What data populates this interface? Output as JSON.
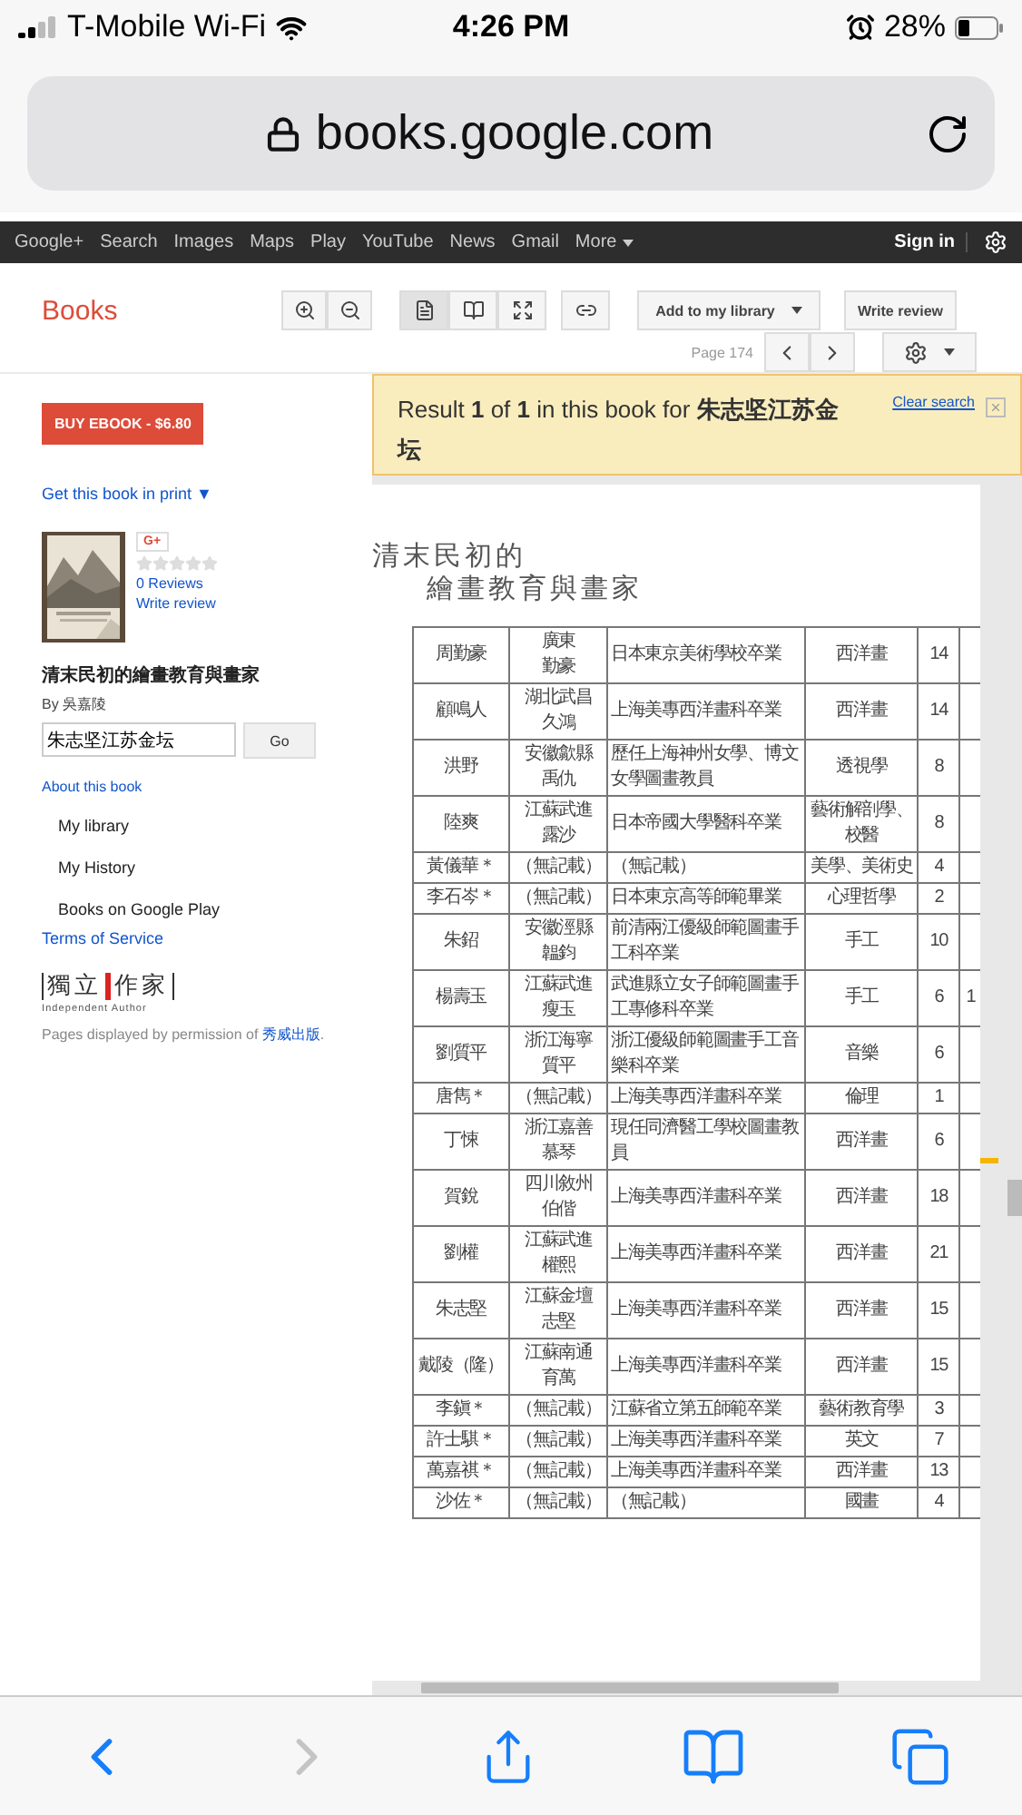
{
  "status_bar": {
    "carrier": "T-Mobile Wi-Fi",
    "time": "4:26 PM",
    "battery": "28%"
  },
  "address_bar": {
    "url": "books.google.com"
  },
  "google_bar": {
    "links": [
      "Google+",
      "Search",
      "Images",
      "Maps",
      "Play",
      "YouTube",
      "News",
      "Gmail"
    ],
    "more": "More",
    "sign_in": "Sign in"
  },
  "header": {
    "title": "Books",
    "add_to_library": "Add to my library",
    "write_review": "Write review",
    "page": "Page 174",
    "view_modes": [
      {
        "kind": "single",
        "selected": true
      },
      {
        "kind": "double",
        "selected": false
      },
      {
        "kind": "fullscreen",
        "selected": false
      }
    ]
  },
  "sidebar": {
    "buy": "BUY EBOOK - $6.80",
    "get_print": "Get this book in print ▼",
    "gplus": "G+",
    "stars": 0,
    "reviews": "0 Reviews",
    "write_review": "Write review",
    "book_title": "清末民初的繪畫教育與畫家",
    "author": "By 吳嘉陵",
    "search_value": "朱志坚江苏金坛",
    "go": "Go",
    "about": "About this book",
    "menu": [
      "My library",
      "My History",
      "Books on Google Play"
    ],
    "terms": "Terms of Service",
    "publisher_logo": {
      "left": "獨立",
      "right": "作家",
      "subtitle": "Independent Author"
    },
    "permission": "Pages displayed by permission of",
    "publisher": "秀威出版",
    "permission_end": "."
  },
  "result": {
    "text": "Result **1** of **1** in this book for **朱志坚江苏金坛**",
    "clear": "Clear search"
  },
  "page": {
    "title_lines": [
      "清末民初的",
      "繪畫教育與畫家"
    ],
    "rows": [
      {
        "name": "周勤豪",
        "origin": [
          "廣東",
          "勤豪"
        ],
        "education": "日本東京美術學校卒業",
        "subject": "西洋畫",
        "count": "14"
      },
      {
        "name": "顧鳴人",
        "origin": [
          "湖北武昌",
          "久鴻"
        ],
        "education": "上海美專西洋畫科卒業",
        "subject": "西洋畫",
        "count": "14"
      },
      {
        "name": "洪野",
        "origin": [
          "安徽歙縣",
          "禹仇"
        ],
        "education": "歷任上海神州女學、博文女學圖畫教員",
        "subject": "透視學",
        "count": "8"
      },
      {
        "name": "陸爽",
        "origin": [
          "江蘇武進",
          "露沙"
        ],
        "education": "日本帝國大學醫科卒業",
        "subject": "藝術解剖學、校醫",
        "count": "8"
      },
      {
        "name": "黃儀華＊",
        "origin": [
          "（無記載）"
        ],
        "education": "（無記載）",
        "subject": "美學、美術史",
        "count": "4"
      },
      {
        "name": "李石岑＊",
        "origin": [
          "（無記載）"
        ],
        "education": "日本東京高等師範畢業",
        "subject": "心理哲學",
        "count": "2"
      },
      {
        "name": "朱鉊",
        "origin": [
          "安徽涇縣",
          "韞鈞"
        ],
        "education": "前清兩江優級師範圖畫手工科卒業",
        "subject": "手工",
        "count": "10"
      },
      {
        "name": "楊壽玉",
        "origin": [
          "江蘇武進",
          "瘦玉"
        ],
        "education": "武進縣立女子師範圖畫手工專修科卒業",
        "subject": "手工",
        "count": "6",
        "column_6": "1"
      },
      {
        "name": "劉質平",
        "origin": [
          "浙江海寧",
          "質平"
        ],
        "education": "浙江優級師範圖畫手工音樂科卒業",
        "subject": "音樂",
        "count": "6"
      },
      {
        "name": "唐雋＊",
        "origin": [
          "（無記載）"
        ],
        "education": "上海美專西洋畫科卒業",
        "subject": "倫理",
        "count": "1"
      },
      {
        "name": "丁悚",
        "origin": [
          "浙江嘉善",
          "慕琴"
        ],
        "education": "現任同濟醫工學校圖畫教員",
        "subject": "西洋畫",
        "count": "6"
      },
      {
        "name": "賀銳",
        "origin": [
          "四川敘州",
          "伯偕"
        ],
        "education": "上海美專西洋畫科卒業",
        "subject": "西洋畫",
        "count": "18"
      },
      {
        "name": "劉權",
        "origin": [
          "江蘇武進",
          "權熙"
        ],
        "education": "上海美專西洋畫科卒業",
        "subject": "西洋畫",
        "count": "21"
      },
      {
        "name": "朱志堅",
        "origin": [
          "江蘇金壇",
          "志堅"
        ],
        "education": "上海美專西洋畫科卒業",
        "subject": "西洋畫",
        "count": "15"
      },
      {
        "name": "戴陵（隆）",
        "origin": [
          "江蘇南通",
          "育萬"
        ],
        "education": "上海美專西洋畫科卒業",
        "subject": "西洋畫",
        "count": "15"
      },
      {
        "name": "李鎭＊",
        "origin": [
          "（無記載）"
        ],
        "education": "江蘇省立第五師範卒業",
        "subject": "藝術教育學",
        "count": "3"
      },
      {
        "name": "許士騏＊",
        "origin": [
          "（無記載）"
        ],
        "education": "上海美專西洋畫科卒業",
        "subject": "英文",
        "count": "7"
      },
      {
        "name": "萬嘉祺＊",
        "origin": [
          "（無記載）"
        ],
        "education": "上海美專西洋畫科卒業",
        "subject": "西洋畫",
        "count": "13"
      },
      {
        "name": "沙佐＊",
        "origin": [
          "（無記載）"
        ],
        "education": "（無記載）",
        "subject": "國畫",
        "count": "4"
      }
    ]
  },
  "toolbar": [
    {
      "kind": "back",
      "disabled": false
    },
    {
      "kind": "forward",
      "disabled": true
    },
    {
      "kind": "share",
      "disabled": false
    },
    {
      "kind": "bookmarks",
      "disabled": false
    },
    {
      "kind": "tabs",
      "disabled": false
    }
  ]
}
